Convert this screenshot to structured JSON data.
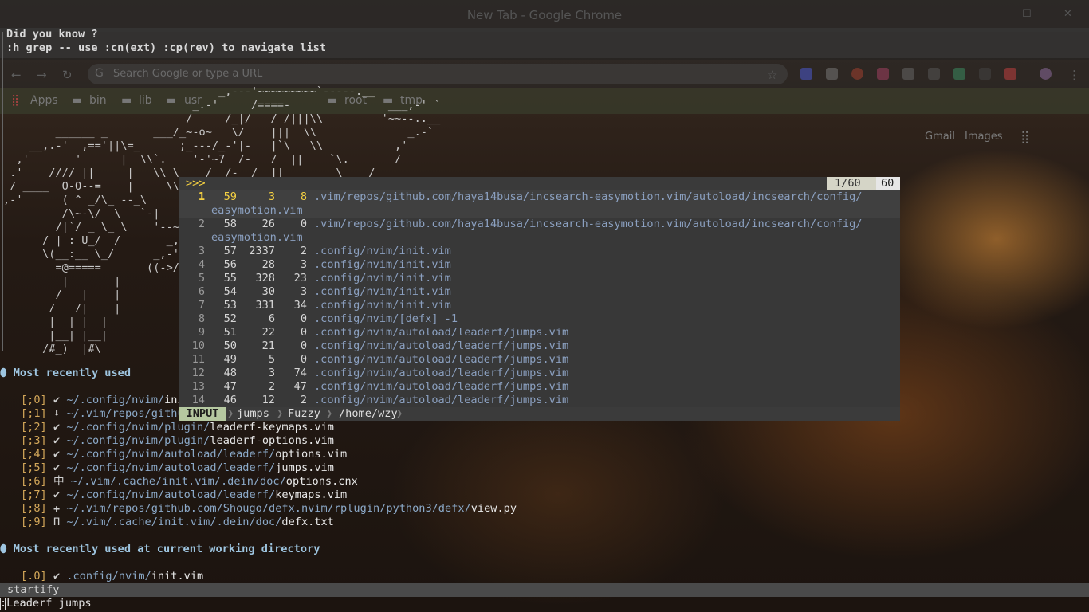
{
  "chrome": {
    "window_title": "New Tab - Google Chrome",
    "omnibox_placeholder": "Search Google or type a URL",
    "bookmarks": [
      "Apps",
      "bin",
      "lib",
      "usr",
      "root",
      "tmp"
    ],
    "home_links": [
      "Gmail",
      "Images"
    ]
  },
  "tip": {
    "line1": "Did you know ?",
    "line2": ":h grep -- use :cn(ext) :cp(rev) to navigate list"
  },
  "startify": {
    "ascii_art": "\n                                 _,---'~~~~~~~~~`-----.__\n                             _.-'     /====-               ___,-' `\n                            /     /_|/   / /|||\\\\         '~~--..__\n        ______ _       ___/_~-o~   \\/    |||  \\\\              _.-`\n    __,.-'  ,=='||\\=_      ;_---/_-'|-   |`\\   \\\\           ,'\n  ,'       '      |  \\\\`.    '-'~7  /-   /  ||    `\\.       /\n .'    //// ||     |   \\\\ \\_   /  /-  /  ||        \\    /\n / ____  O-O--=    |     \\\\`-_/  /|- _/   ,||         \\  /\n,-'      ( ^ _/\\_ --_\\\n         /\\~-\\/  \\   `-|\n        /|`/ _ \\_ \\    '--~\\\n      / | : U_/  /       _,-'\n      \\(__:__ \\_/      _,-'\n        =@=====       ((->/\n         |       |\n        /   |    |\n       /   /|    |\n       |  | |  |\n       |__| |__|\n      /#_)  |#\\",
    "mru_title": "Most recently used",
    "mru": [
      {
        "idx": "[;0]",
        "icon": "✔",
        "dir": "~/.config/nvim/",
        "file": "ini"
      },
      {
        "idx": "[;1]",
        "icon": "⬇",
        "dir": "~/.vim/repos/githu",
        "file": ""
      },
      {
        "idx": "[;2]",
        "icon": "✔",
        "dir": "~/.config/nvim/plugin/",
        "file": "leaderf-keymaps.vim"
      },
      {
        "idx": "[;3]",
        "icon": "✔",
        "dir": "~/.config/nvim/plugin/",
        "file": "leaderf-options.vim"
      },
      {
        "idx": "[;4]",
        "icon": "✔",
        "dir": "~/.config/nvim/autoload/leaderf/",
        "file": "options.vim"
      },
      {
        "idx": "[;5]",
        "icon": "✔",
        "dir": "~/.config/nvim/autoload/leaderf/",
        "file": "jumps.vim"
      },
      {
        "idx": "[;6]",
        "icon": "中",
        "dir": "~/.vim/.cache/init.vim/.dein/doc/",
        "file": "options.cnx"
      },
      {
        "idx": "[;7]",
        "icon": "✔",
        "dir": "~/.config/nvim/autoload/leaderf/",
        "file": "keymaps.vim"
      },
      {
        "idx": "[;8]",
        "icon": "✚",
        "dir": "~/.vim/repos/github.com/Shougo/defx.nvim/rplugin/python3/defx/",
        "file": "view.py"
      },
      {
        "idx": "[;9]",
        "icon": "Π",
        "dir": "~/.vim/.cache/init.vim/.dein/doc/",
        "file": "defx.txt"
      }
    ],
    "cwd_title": "Most recently used at current working directory",
    "cwd": [
      {
        "idx": "[.0]",
        "icon": "✔",
        "dir": ".config/nvim/",
        "file": "init.vim"
      }
    ]
  },
  "leaderf": {
    "prompt": ">>>",
    "count": "1/60",
    "total": "60",
    "rows": [
      {
        "n": "1",
        "a": "59",
        "b": "3",
        "c": "8",
        "path": ".vim/repos/github.com/haya14busa/incsearch-easymotion.vim/autoload/incsearch/config/",
        "cont": "easymotion.vim"
      },
      {
        "n": "2",
        "a": "58",
        "b": "26",
        "c": "0",
        "path": ".vim/repos/github.com/haya14busa/incsearch-easymotion.vim/autoload/incsearch/config/",
        "cont": "easymotion.vim"
      },
      {
        "n": "3",
        "a": "57",
        "b": "2337",
        "c": "2",
        "path": ".config/nvim/init.vim"
      },
      {
        "n": "4",
        "a": "56",
        "b": "28",
        "c": "3",
        "path": ".config/nvim/init.vim"
      },
      {
        "n": "5",
        "a": "55",
        "b": "328",
        "c": "23",
        "path": ".config/nvim/init.vim"
      },
      {
        "n": "6",
        "a": "54",
        "b": "30",
        "c": "3",
        "path": ".config/nvim/init.vim"
      },
      {
        "n": "7",
        "a": "53",
        "b": "331",
        "c": "34",
        "path": ".config/nvim/init.vim"
      },
      {
        "n": "8",
        "a": "52",
        "b": "6",
        "c": "0",
        "path": ".config/nvim/[defx] -1"
      },
      {
        "n": "9",
        "a": "51",
        "b": "22",
        "c": "0",
        "path": ".config/nvim/autoload/leaderf/jumps.vim"
      },
      {
        "n": "10",
        "a": "50",
        "b": "21",
        "c": "0",
        "path": ".config/nvim/autoload/leaderf/jumps.vim"
      },
      {
        "n": "11",
        "a": "49",
        "b": "5",
        "c": "0",
        "path": ".config/nvim/autoload/leaderf/jumps.vim"
      },
      {
        "n": "12",
        "a": "48",
        "b": "3",
        "c": "74",
        "path": ".config/nvim/autoload/leaderf/jumps.vim"
      },
      {
        "n": "13",
        "a": "47",
        "b": "2",
        "c": "47",
        "path": ".config/nvim/autoload/leaderf/jumps.vim"
      },
      {
        "n": "14",
        "a": "46",
        "b": "12",
        "c": "2",
        "path": ".config/nvim/autoload/leaderf/jumps.vim"
      }
    ],
    "status": {
      "mode": "INPUT",
      "category": "jumps",
      "matcher": "Fuzzy",
      "cwd": "/home/wzy"
    }
  },
  "statusline": {
    "filetype": "startify"
  },
  "cmdline": ":Leaderf jumps"
}
